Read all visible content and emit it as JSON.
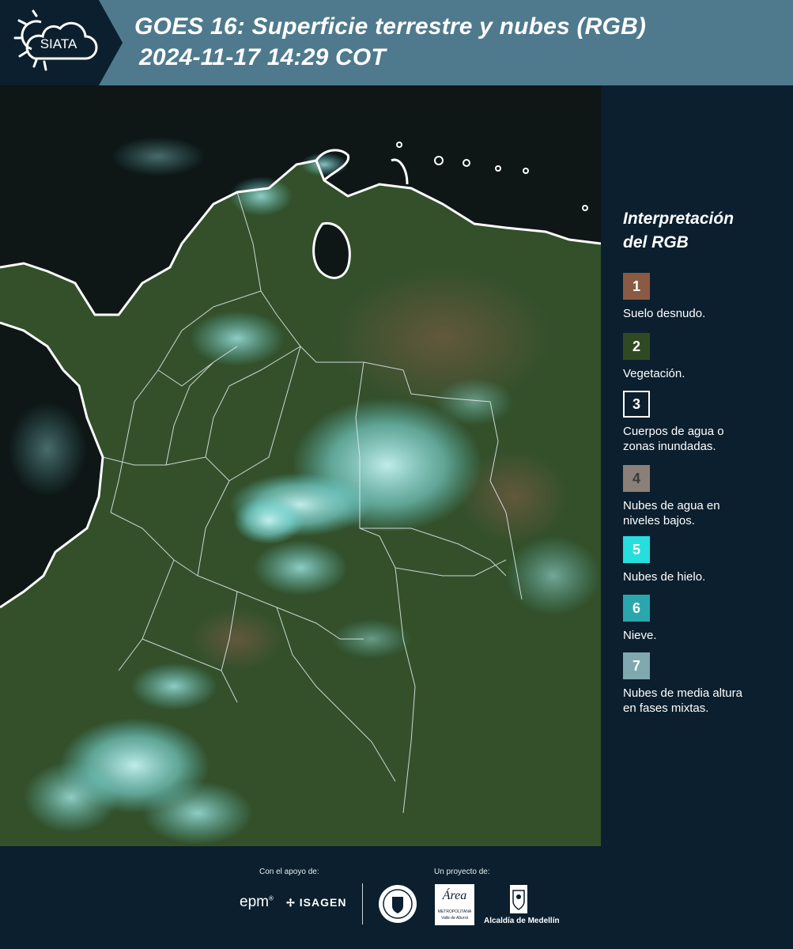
{
  "header": {
    "title_line1": "GOES 16: Superficie terrestre y nubes (RGB)",
    "title_line2": "2024-11-17 14:29 COT",
    "logo_text": "SIATA"
  },
  "legend": {
    "title_line1": "Interpretación",
    "title_line2": "del RGB",
    "items": [
      {
        "number": "1",
        "label_line1": "Suelo desnudo.",
        "label_line2": "",
        "color": "#8a5a44"
      },
      {
        "number": "2",
        "label_line1": "Vegetación.",
        "label_line2": "",
        "color": "#2f4a22"
      },
      {
        "number": "3",
        "label_line1": "Cuerpos de agua o",
        "label_line2": "zonas inundadas.",
        "color": "#0b1f2e"
      },
      {
        "number": "4",
        "label_line1": "Nubes de agua en",
        "label_line2": "niveles bajos.",
        "color": "#8a8078"
      },
      {
        "number": "5",
        "label_line1": "Nubes de hielo.",
        "label_line2": "",
        "color": "#27dede"
      },
      {
        "number": "6",
        "label_line1": "Nieve.",
        "label_line2": "",
        "color": "#2aa6ad"
      },
      {
        "number": "7",
        "label_line1": "Nubes de media altura",
        "label_line2": "en fases mixtas.",
        "color": "#7fa9ae"
      }
    ]
  },
  "footer": {
    "support_caption": "Con el apoyo de:",
    "project_caption": "Un proyecto de:",
    "sponsor_epm": "epm",
    "sponsor_isagen": "ISAGEN",
    "area_text": "Área",
    "area_sub1": "METROPOLITANA",
    "area_sub2": "Valle de Aburrá",
    "alcaldia_text": "Alcaldía de Medellín"
  }
}
